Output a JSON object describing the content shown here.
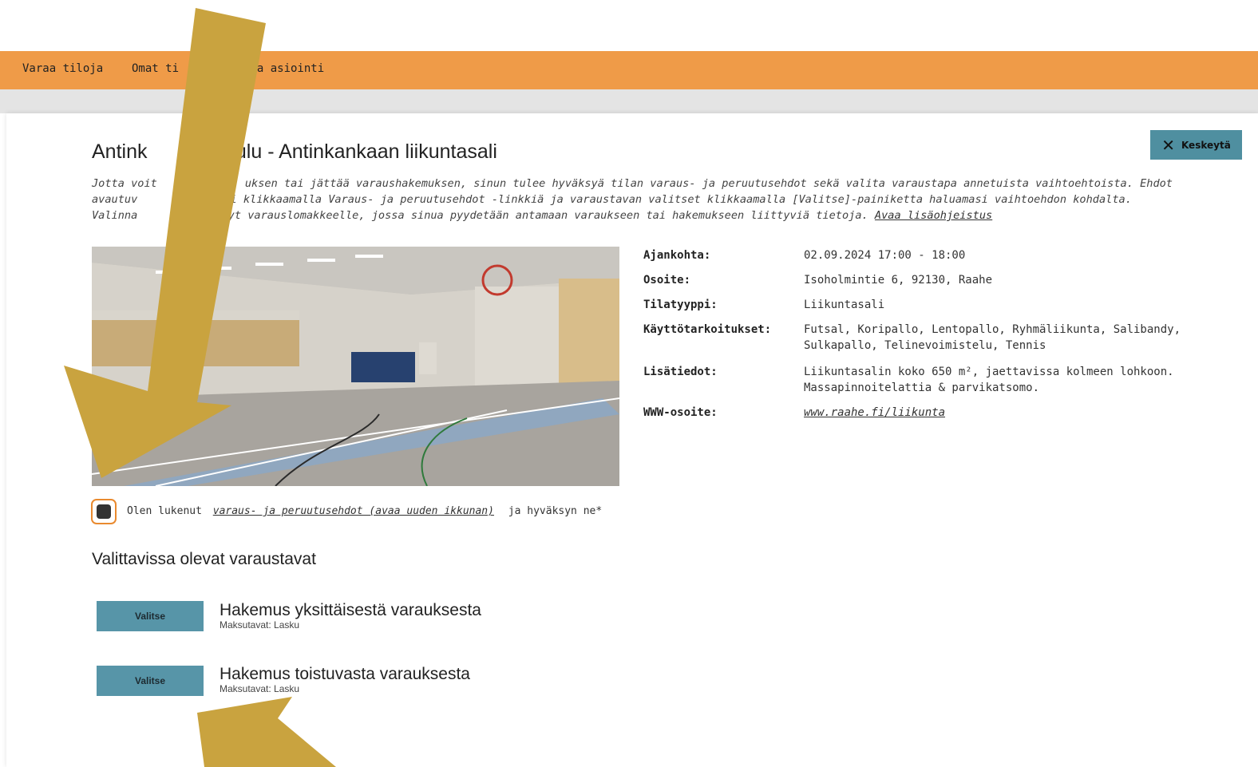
{
  "nav": {
    "items": [
      {
        "label": "Varaa tiloja"
      },
      {
        "label": "Omat ti"
      },
      {
        "label": "oma asiointi"
      }
    ]
  },
  "header": {
    "cancel_label": "Keskeytä"
  },
  "title": {
    "left": "Antink",
    "right": "koulu - Antinkankaan liikuntasali"
  },
  "intro": {
    "line1_a": "Jotta voit",
    "line1_b": "uksen tai jättää varaushakemuksen, sinun tulee hyväksyä tilan varaus- ja peruutusehdot sekä valita varaustapa annetuista vaihtoehtoista. Ehdot",
    "line2_a": "avautuv",
    "line2_b": "si klikkaamalla Varaus- ja peruutusehdot -linkkiä ja varaustavan valitset klikkaamalla [Valitse]-painiketta haluamasi vaihtoehdon kohdalta.",
    "line3_a": "Valinna",
    "line3_b": "rryt varauslomakkeelle, jossa sinua pyydetään antamaan varaukseen tai hakemukseen liittyviä tietoja.",
    "help_link": "Avaa lisäohjeistus"
  },
  "details": {
    "rows": [
      {
        "label": "Ajankohta:",
        "value": "02.09.2024 17:00 - 18:00"
      },
      {
        "label": "Osoite:",
        "value": "Isoholmintie 6, 92130, Raahe"
      },
      {
        "label": "Tilatyyppi:",
        "value": "Liikuntasali"
      },
      {
        "label": "Käyttötarkoitukset:",
        "value": "Futsal, Koripallo, Lentopallo, Ryhmäliikunta, Salibandy, Sulkapallo, Telinevoimistelu, Tennis"
      },
      {
        "label": "Lisätiedot:",
        "value": "Liikuntasalin koko 650 m², jaettavissa kolmeen lohkoon. Massapinnoitelattia & parvikatsomo."
      },
      {
        "label": "WWW-osoite:",
        "value": "www.raahe.fi/liikunta"
      }
    ]
  },
  "agree": {
    "prefix": "Olen lukenut",
    "link": "varaus- ja peruutusehdot (avaa uuden ikkunan)",
    "suffix": "ja hyväksyn ne*"
  },
  "options": {
    "heading": "Valittavissa olevat varaustavat",
    "items": [
      {
        "button": "Valitse",
        "title": "Hakemus yksittäisestä varauksesta",
        "sub": "Maksutavat: Lasku"
      },
      {
        "button": "Valitse",
        "title": "Hakemus toistuvasta varauksesta",
        "sub": "Maksutavat: Lasku"
      }
    ]
  },
  "colors": {
    "topbar": "#ef9b48",
    "button": "#5795a8",
    "annotation_arrow": "#c9a33f"
  }
}
